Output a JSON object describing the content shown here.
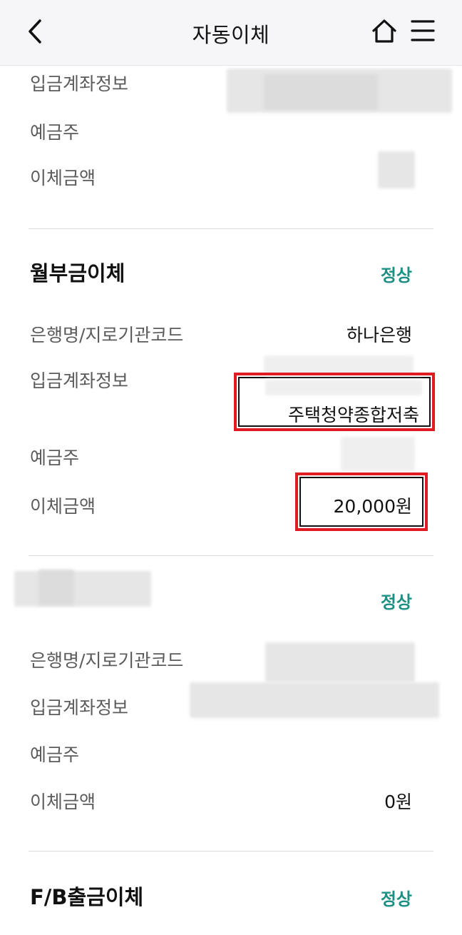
{
  "header": {
    "title": "자동이체"
  },
  "section1": {
    "rows": [
      {
        "label": "입금계좌정보"
      },
      {
        "label": "예금주"
      },
      {
        "label": "이체금액"
      }
    ]
  },
  "section2": {
    "title": "월부금이체",
    "status": "정상",
    "bank_label": "은행명/지로기관코드",
    "bank_value": "하나은행",
    "account_label": "입금계좌정보",
    "account_product": "주택청약종합저축",
    "holder_label": "예금주",
    "amount_label": "이체금액",
    "amount_value": "20,000원"
  },
  "section3": {
    "status": "정상",
    "bank_label": "은행명/지로기관코드",
    "account_label": "입금계좌정보",
    "holder_label": "예금주",
    "amount_label": "이체금액",
    "amount_value": "0원"
  },
  "section4": {
    "title": "F/B출금이체",
    "status": "정상"
  },
  "colors": {
    "status": "#1e8f83",
    "highlight_border": "#e01b22",
    "header_bg": "#f6f6f8"
  },
  "icons": [
    "back-arrow-icon",
    "home-icon",
    "hamburger-menu-icon"
  ]
}
